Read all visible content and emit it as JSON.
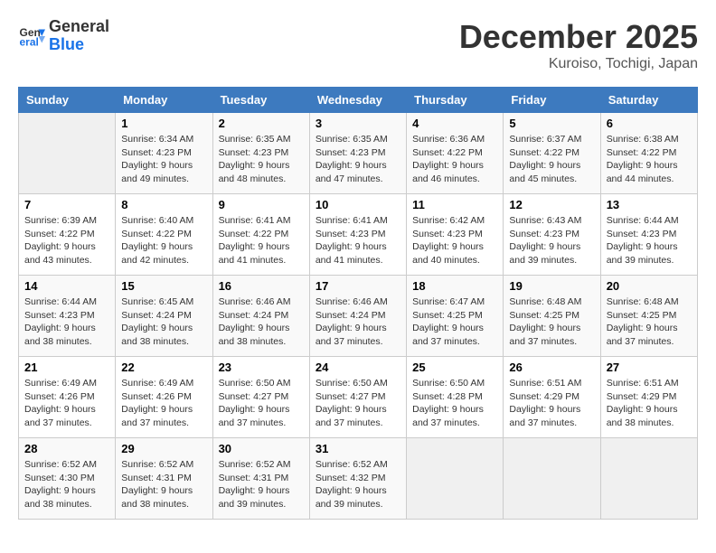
{
  "logo": {
    "general": "General",
    "blue": "Blue"
  },
  "title": "December 2025",
  "subtitle": "Kuroiso, Tochigi, Japan",
  "days_header": [
    "Sunday",
    "Monday",
    "Tuesday",
    "Wednesday",
    "Thursday",
    "Friday",
    "Saturday"
  ],
  "weeks": [
    [
      {
        "day": "",
        "info": ""
      },
      {
        "day": "1",
        "info": "Sunrise: 6:34 AM\nSunset: 4:23 PM\nDaylight: 9 hours\nand 49 minutes."
      },
      {
        "day": "2",
        "info": "Sunrise: 6:35 AM\nSunset: 4:23 PM\nDaylight: 9 hours\nand 48 minutes."
      },
      {
        "day": "3",
        "info": "Sunrise: 6:35 AM\nSunset: 4:23 PM\nDaylight: 9 hours\nand 47 minutes."
      },
      {
        "day": "4",
        "info": "Sunrise: 6:36 AM\nSunset: 4:22 PM\nDaylight: 9 hours\nand 46 minutes."
      },
      {
        "day": "5",
        "info": "Sunrise: 6:37 AM\nSunset: 4:22 PM\nDaylight: 9 hours\nand 45 minutes."
      },
      {
        "day": "6",
        "info": "Sunrise: 6:38 AM\nSunset: 4:22 PM\nDaylight: 9 hours\nand 44 minutes."
      }
    ],
    [
      {
        "day": "7",
        "info": "Sunrise: 6:39 AM\nSunset: 4:22 PM\nDaylight: 9 hours\nand 43 minutes."
      },
      {
        "day": "8",
        "info": "Sunrise: 6:40 AM\nSunset: 4:22 PM\nDaylight: 9 hours\nand 42 minutes."
      },
      {
        "day": "9",
        "info": "Sunrise: 6:41 AM\nSunset: 4:22 PM\nDaylight: 9 hours\nand 41 minutes."
      },
      {
        "day": "10",
        "info": "Sunrise: 6:41 AM\nSunset: 4:23 PM\nDaylight: 9 hours\nand 41 minutes."
      },
      {
        "day": "11",
        "info": "Sunrise: 6:42 AM\nSunset: 4:23 PM\nDaylight: 9 hours\nand 40 minutes."
      },
      {
        "day": "12",
        "info": "Sunrise: 6:43 AM\nSunset: 4:23 PM\nDaylight: 9 hours\nand 39 minutes."
      },
      {
        "day": "13",
        "info": "Sunrise: 6:44 AM\nSunset: 4:23 PM\nDaylight: 9 hours\nand 39 minutes."
      }
    ],
    [
      {
        "day": "14",
        "info": "Sunrise: 6:44 AM\nSunset: 4:23 PM\nDaylight: 9 hours\nand 38 minutes."
      },
      {
        "day": "15",
        "info": "Sunrise: 6:45 AM\nSunset: 4:24 PM\nDaylight: 9 hours\nand 38 minutes."
      },
      {
        "day": "16",
        "info": "Sunrise: 6:46 AM\nSunset: 4:24 PM\nDaylight: 9 hours\nand 38 minutes."
      },
      {
        "day": "17",
        "info": "Sunrise: 6:46 AM\nSunset: 4:24 PM\nDaylight: 9 hours\nand 37 minutes."
      },
      {
        "day": "18",
        "info": "Sunrise: 6:47 AM\nSunset: 4:25 PM\nDaylight: 9 hours\nand 37 minutes."
      },
      {
        "day": "19",
        "info": "Sunrise: 6:48 AM\nSunset: 4:25 PM\nDaylight: 9 hours\nand 37 minutes."
      },
      {
        "day": "20",
        "info": "Sunrise: 6:48 AM\nSunset: 4:25 PM\nDaylight: 9 hours\nand 37 minutes."
      }
    ],
    [
      {
        "day": "21",
        "info": "Sunrise: 6:49 AM\nSunset: 4:26 PM\nDaylight: 9 hours\nand 37 minutes."
      },
      {
        "day": "22",
        "info": "Sunrise: 6:49 AM\nSunset: 4:26 PM\nDaylight: 9 hours\nand 37 minutes."
      },
      {
        "day": "23",
        "info": "Sunrise: 6:50 AM\nSunset: 4:27 PM\nDaylight: 9 hours\nand 37 minutes."
      },
      {
        "day": "24",
        "info": "Sunrise: 6:50 AM\nSunset: 4:27 PM\nDaylight: 9 hours\nand 37 minutes."
      },
      {
        "day": "25",
        "info": "Sunrise: 6:50 AM\nSunset: 4:28 PM\nDaylight: 9 hours\nand 37 minutes."
      },
      {
        "day": "26",
        "info": "Sunrise: 6:51 AM\nSunset: 4:29 PM\nDaylight: 9 hours\nand 37 minutes."
      },
      {
        "day": "27",
        "info": "Sunrise: 6:51 AM\nSunset: 4:29 PM\nDaylight: 9 hours\nand 38 minutes."
      }
    ],
    [
      {
        "day": "28",
        "info": "Sunrise: 6:52 AM\nSunset: 4:30 PM\nDaylight: 9 hours\nand 38 minutes."
      },
      {
        "day": "29",
        "info": "Sunrise: 6:52 AM\nSunset: 4:31 PM\nDaylight: 9 hours\nand 38 minutes."
      },
      {
        "day": "30",
        "info": "Sunrise: 6:52 AM\nSunset: 4:31 PM\nDaylight: 9 hours\nand 39 minutes."
      },
      {
        "day": "31",
        "info": "Sunrise: 6:52 AM\nSunset: 4:32 PM\nDaylight: 9 hours\nand 39 minutes."
      },
      {
        "day": "",
        "info": ""
      },
      {
        "day": "",
        "info": ""
      },
      {
        "day": "",
        "info": ""
      }
    ]
  ]
}
